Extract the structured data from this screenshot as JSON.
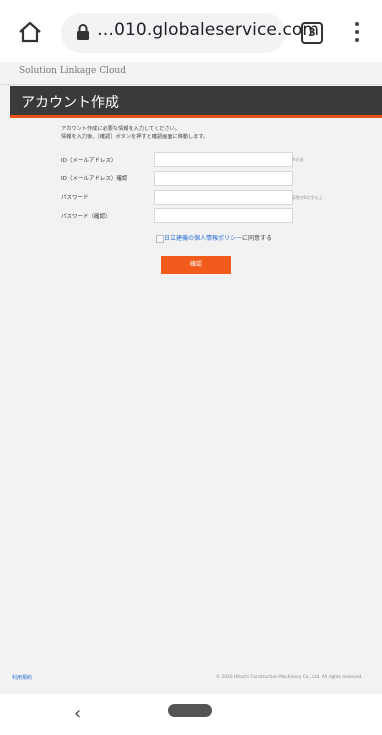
{
  "browser": {
    "url": "…010.globaleservice.com",
    "tab_count": "3"
  },
  "site": {
    "brand": "Solution Linkage Cloud",
    "page_title": "アカウント作成"
  },
  "intro": {
    "line1": "アカウント作成に必要な情報を入力してください。",
    "line2": "情報を入力後、［確認］ボタンを押すと確認画面に移動します。"
  },
  "form": {
    "email_label": "ID（メールアドレス）",
    "email_hint": "※必須",
    "email_confirm_label": "ID（メールアドレス）確認",
    "password_label": "パスワード",
    "password_hint": "英数字8文字以上",
    "password_confirm_label": "パスワード（確認）",
    "agree_link": "日立建機の個人情報ポリシー",
    "agree_suffix": "に同意する",
    "confirm_button": "確認"
  },
  "footer": {
    "terms_link": "利用規約",
    "copyright": "© 2020 Hitachi Construction Machinery Co., Ltd. All rights reserved."
  },
  "colors": {
    "accent": "#e8501c",
    "header_bg": "#3a3a3a",
    "link": "#2a6fd6"
  }
}
